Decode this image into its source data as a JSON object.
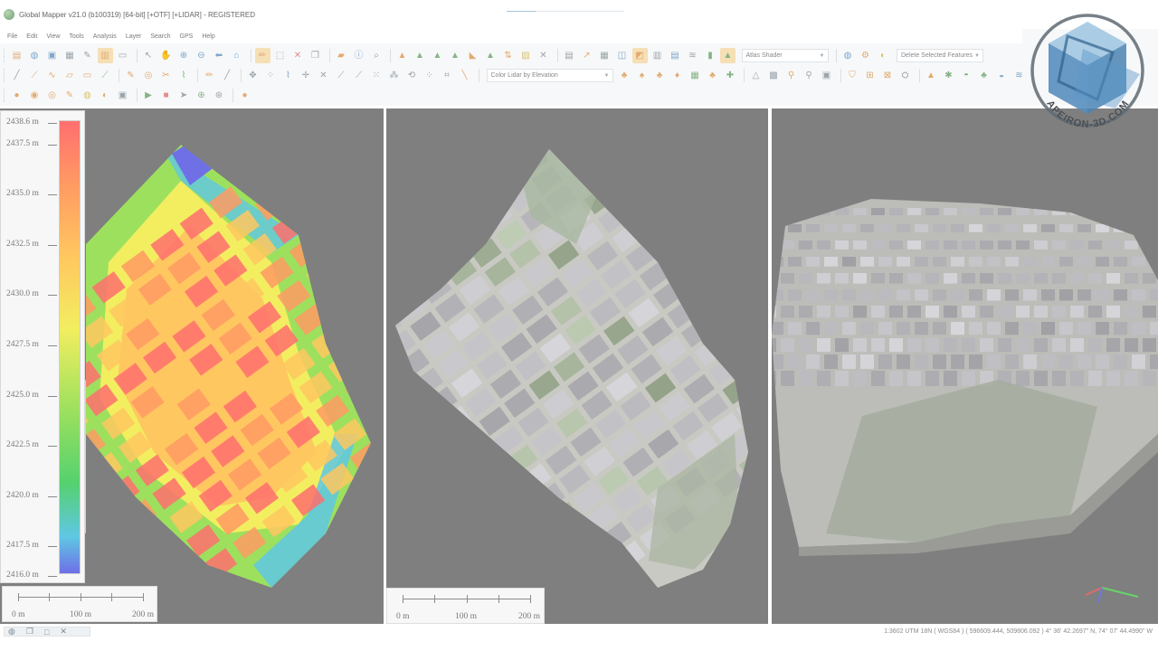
{
  "window": {
    "title": "Global Mapper v21.0 (b100319) [64-bit] [+OTF] [+LIDAR] - REGISTERED"
  },
  "menu": [
    "File",
    "Edit",
    "View",
    "Tools",
    "Analysis",
    "Layer",
    "Search",
    "GPS",
    "Help"
  ],
  "toolbar": {
    "shader_select": "Atlas Shader",
    "delete_feature_select": "Delete Selected Features",
    "lidar_color_select": "Color Lidar by Elevation"
  },
  "legend": {
    "labels": [
      "2438.6 m",
      "2437.5 m",
      "2435.0 m",
      "2432.5 m",
      "2430.0 m",
      "2427.5 m",
      "2425.0 m",
      "2422.5 m",
      "2420.0 m",
      "2417.5 m",
      "2416.0 m"
    ],
    "gradient_colors": [
      "#ff6f6f",
      "#ff9a63",
      "#ffc760",
      "#f2ee60",
      "#9de05e",
      "#55d16f",
      "#5fc7e4",
      "#6f6fe6"
    ]
  },
  "scale_bar": {
    "labels": [
      "0 m",
      "100 m",
      "200 m"
    ]
  },
  "watermark": {
    "text": "APEIRON-3D.COM"
  },
  "status_bar": {
    "text": "1:3602  UTM 18N ( WGS84 ) ( 596609.444, 509806.092 )  4° 36' 42.2697\" N, 74° 07' 44.4990\" W"
  },
  "taskbar": {
    "icons": [
      "globe-icon",
      "restore-icon",
      "maximize-icon",
      "close-icon"
    ]
  },
  "colors": {
    "view_background": "#7f7f7f",
    "active_tool": "#f5dfb4",
    "accent_blue": "#4f86b8"
  }
}
